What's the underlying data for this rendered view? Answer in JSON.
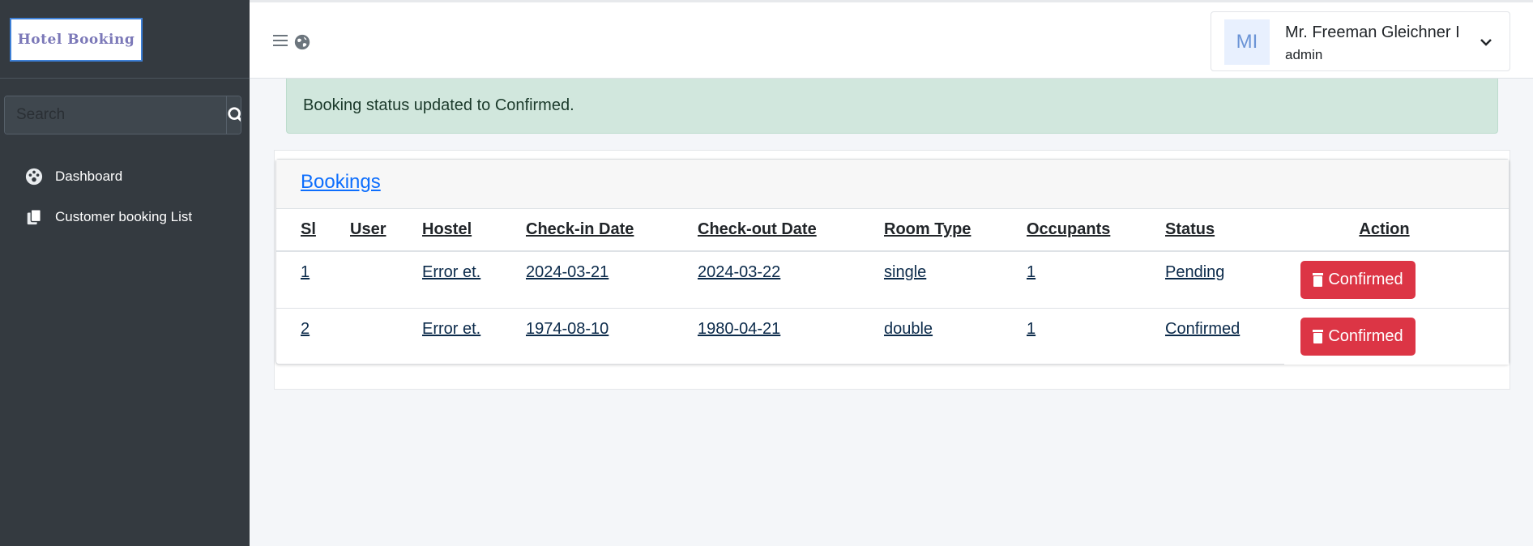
{
  "brand": {
    "logo_text": "Hotel Booking"
  },
  "search": {
    "placeholder": "Search"
  },
  "sidebar": {
    "items": [
      {
        "label": "Dashboard",
        "icon": "palette-icon"
      },
      {
        "label": "Customer booking List",
        "icon": "copy-icon"
      }
    ]
  },
  "topbar": {
    "user": {
      "initials": "MI",
      "name": "Mr. Freeman Gleichner I",
      "role": "admin"
    }
  },
  "alert": {
    "message": "Booking status updated to Confirmed."
  },
  "bookings": {
    "title": "Bookings",
    "columns": [
      "Sl",
      "User",
      "Hostel",
      "Check-in Date",
      "Check-out Date",
      "Room Type",
      "Occupants",
      "Status",
      "Action"
    ],
    "rows": [
      {
        "sl": "1",
        "user": "",
        "hostel": "Error et.",
        "checkin": "2024-03-21",
        "checkout": "2024-03-22",
        "room_type": "single",
        "occupants": "1",
        "status": "Pending",
        "action": "Confirmed"
      },
      {
        "sl": "2",
        "user": "",
        "hostel": "Error et.",
        "checkin": "1974-08-10",
        "checkout": "1980-04-21",
        "room_type": "double",
        "occupants": "1",
        "status": "Confirmed",
        "action": "Confirmed"
      }
    ]
  },
  "colors": {
    "sidebar_bg": "#343a40",
    "alert_bg": "#d1e7dd",
    "danger": "#dc3545",
    "link": "#0d6efd"
  }
}
